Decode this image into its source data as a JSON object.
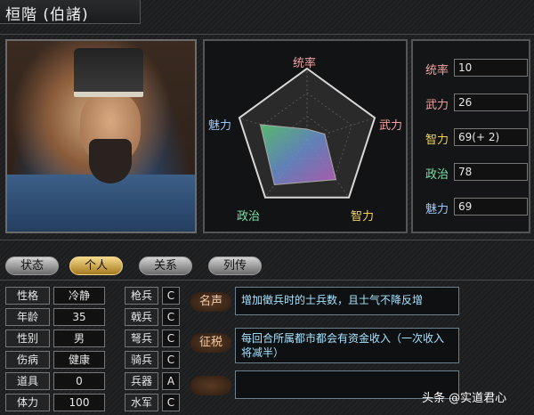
{
  "header": {
    "title": "桓階 (伯諸)"
  },
  "radar": {
    "labels": {
      "leadership": "统率",
      "war": "武力",
      "intelligence": "智力",
      "politics": "政治",
      "charm": "魅力"
    },
    "values": {
      "leadership": 10,
      "war": 26,
      "intelligence": 69,
      "politics": 78,
      "charm": 69
    },
    "max": 100
  },
  "stats": [
    {
      "label": "统率",
      "value": "10",
      "color": "#f2a3a3"
    },
    {
      "label": "武力",
      "value": "26",
      "color": "#f2a3a3"
    },
    {
      "label": "智力",
      "value": "69(+ 2)",
      "color": "#f2d35a"
    },
    {
      "label": "政治",
      "value": "78",
      "color": "#7fe0a8"
    },
    {
      "label": "魅力",
      "value": "69",
      "color": "#9fc7ff"
    }
  ],
  "tabs": [
    {
      "label": "状态",
      "active": false
    },
    {
      "label": "个人",
      "active": true
    },
    {
      "label": "关系",
      "active": false
    },
    {
      "label": "列传",
      "active": false
    }
  ],
  "info": [
    {
      "label": "性格",
      "value": "冷静"
    },
    {
      "label": "年龄",
      "value": "35"
    },
    {
      "label": "性别",
      "value": "男"
    },
    {
      "label": "伤病",
      "value": "健康"
    },
    {
      "label": "道具",
      "value": "0"
    },
    {
      "label": "体力",
      "value": "100"
    }
  ],
  "troops": [
    {
      "label": "枪兵",
      "value": "C"
    },
    {
      "label": "戟兵",
      "value": "C"
    },
    {
      "label": "弩兵",
      "value": "C"
    },
    {
      "label": "骑兵",
      "value": "C"
    },
    {
      "label": "兵器",
      "value": "A"
    },
    {
      "label": "水军",
      "value": "C"
    }
  ],
  "skills": [
    {
      "name": "名声",
      "desc": "增加徵兵时的士兵数，且士气不降反增"
    },
    {
      "name": "征税",
      "desc": "每回合所属都市都会有资金收入（一次收入将减半）"
    },
    {
      "name": "",
      "desc": ""
    }
  ],
  "watermark": "头条 @实道君心"
}
